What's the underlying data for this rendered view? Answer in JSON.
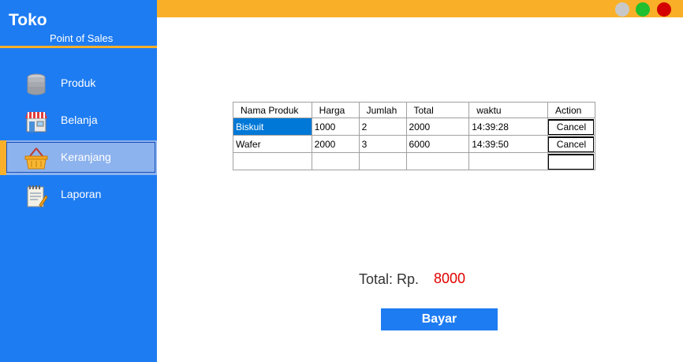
{
  "sidebar": {
    "title": "Toko",
    "subtitle": "Point of Sales",
    "items": [
      {
        "label": "Produk",
        "icon": "database-icon",
        "active": false
      },
      {
        "label": "Belanja",
        "icon": "store-icon",
        "active": false
      },
      {
        "label": "Keranjang",
        "icon": "basket-icon",
        "active": true
      },
      {
        "label": "Laporan",
        "icon": "notepad-icon",
        "active": false
      }
    ]
  },
  "window": {
    "buttons": [
      {
        "name": "minimize",
        "color": "#c8c8c8"
      },
      {
        "name": "maximize",
        "color": "#1fbf2f"
      },
      {
        "name": "close",
        "color": "#d40000"
      }
    ]
  },
  "cart_table": {
    "headers": [
      "Nama Produk",
      "Harga",
      "Jumlah",
      "Total",
      "waktu",
      "Action"
    ],
    "rows": [
      {
        "nama": "Biskuit",
        "harga": "1000",
        "jumlah": "2",
        "total": "2000",
        "waktu": "14:39:28",
        "action": "Cancel"
      },
      {
        "nama": "Wafer",
        "harga": "2000",
        "jumlah": "3",
        "total": "6000",
        "waktu": "14:39:50",
        "action": "Cancel"
      }
    ]
  },
  "summary": {
    "total_label": "Total: Rp.",
    "total_value": "8000"
  },
  "actions": {
    "pay_label": "Bayar"
  },
  "colors": {
    "sidebar": "#1e7cf2",
    "accent": "#f9b028",
    "total_value": "#e00000",
    "selected_cell": "#0078d7"
  }
}
